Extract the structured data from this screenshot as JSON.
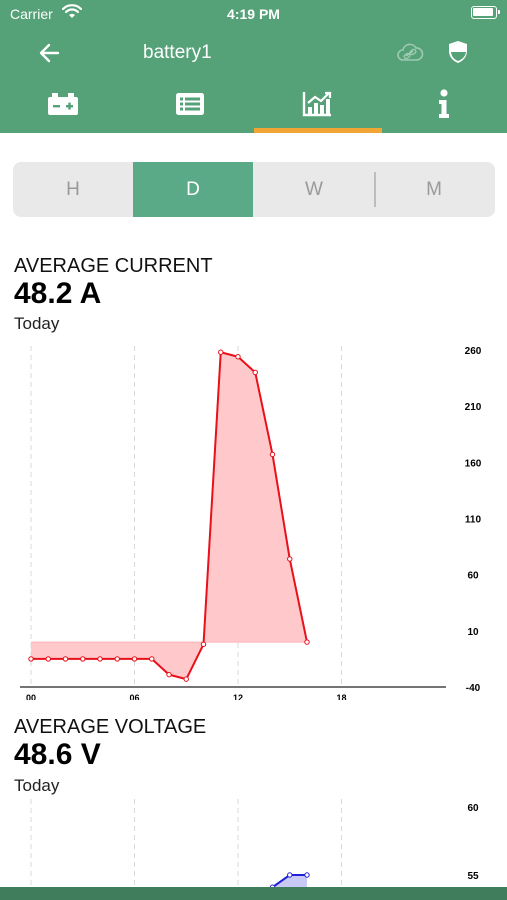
{
  "status_bar": {
    "carrier": "Carrier",
    "time": "4:19 PM"
  },
  "nav": {
    "title": "battery1"
  },
  "tabs": [
    {
      "name": "battery",
      "icon": "battery-icon"
    },
    {
      "name": "list",
      "icon": "list-icon"
    },
    {
      "name": "chart",
      "icon": "chart-icon",
      "active": true
    },
    {
      "name": "info",
      "icon": "info-icon"
    }
  ],
  "segments": {
    "h": "H",
    "d": "D",
    "w": "W",
    "m": "M",
    "selected": "D"
  },
  "current": {
    "label": "AVERAGE CURRENT",
    "value": "48.2 A",
    "period": "Today"
  },
  "voltage": {
    "label": "AVERAGE VOLTAGE",
    "value": "48.6 V",
    "period": "Today"
  },
  "colors": {
    "header_green": "#55a178",
    "active_segment": "#5aaa87",
    "tab_indicator": "#f0a534",
    "current_line": "#e8101a",
    "current_fill": "#ffc9cc",
    "voltage_line": "#2020d8"
  },
  "chart_data": [
    {
      "type": "area",
      "title": "AVERAGE CURRENT",
      "xlim": [
        0,
        24
      ],
      "ylim": [
        -40,
        260
      ],
      "x_ticks": [
        "00",
        "06",
        "12",
        "18"
      ],
      "x_tick_values": [
        0,
        6,
        12,
        18
      ],
      "y_ticks": [
        "260",
        "210",
        "160",
        "110",
        "60",
        "10",
        "-40"
      ],
      "y_tick_values": [
        260,
        210,
        160,
        110,
        60,
        10,
        -40
      ],
      "baseline": 0,
      "grid": "vertical dashed",
      "points": [
        [
          0,
          -15
        ],
        [
          1,
          -15
        ],
        [
          2,
          -15
        ],
        [
          3,
          -15
        ],
        [
          4,
          -15
        ],
        [
          5,
          -15
        ],
        [
          6,
          -15
        ],
        [
          7,
          -15
        ],
        [
          8,
          -29
        ],
        [
          9,
          -33
        ],
        [
          10,
          -2
        ],
        [
          11,
          258
        ],
        [
          12,
          254
        ],
        [
          13,
          240
        ],
        [
          14,
          167
        ],
        [
          15,
          74
        ],
        [
          16,
          0
        ]
      ]
    },
    {
      "type": "area",
      "title": "AVERAGE VOLTAGE",
      "xlim": [
        0,
        24
      ],
      "y_ticks": [
        "60",
        "55"
      ],
      "y_tick_values": [
        60,
        55
      ],
      "grid": "vertical dashed",
      "points": [
        [
          14,
          54.1
        ],
        [
          15,
          55
        ],
        [
          16,
          55
        ]
      ]
    }
  ]
}
